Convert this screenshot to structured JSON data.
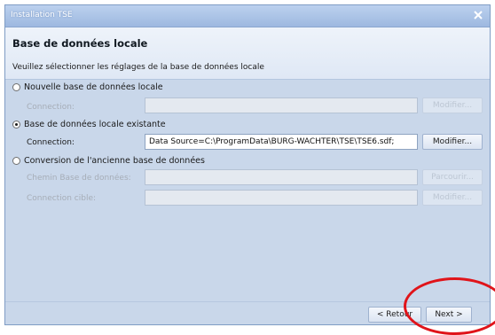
{
  "window": {
    "title": "Installation TSE",
    "close_icon": "close-icon"
  },
  "header": {
    "title": "Base de données locale",
    "description": "Veuillez sélectionner les réglages de la base de données locale"
  },
  "options": [
    {
      "label": "Nouvelle base de données locale",
      "selected": false
    },
    {
      "label": "Base de données locale existante",
      "selected": true
    },
    {
      "label": "Conversion de l'ancienne base de données",
      "selected": false
    }
  ],
  "new_db": {
    "connection_label": "Connection:",
    "connection_value": "",
    "button": "Modifier..."
  },
  "existing_db": {
    "connection_label": "Connection:",
    "connection_value": "Data Source=C:\\ProgramData\\BURG-WACHTER\\TSE\\TSE6.sdf;",
    "button": "Modifier..."
  },
  "conversion": {
    "path_label": "Chemin Base de données:",
    "path_value": "",
    "path_button": "Parcourir...",
    "target_label": "Connection cible:",
    "target_value": "",
    "target_button": "Modifier..."
  },
  "footer": {
    "back": "< Retour",
    "next": "Next >"
  },
  "colors": {
    "annotation": "#e0141a",
    "panel": "#c9d7ea",
    "titlebar": "#9db8e0"
  }
}
